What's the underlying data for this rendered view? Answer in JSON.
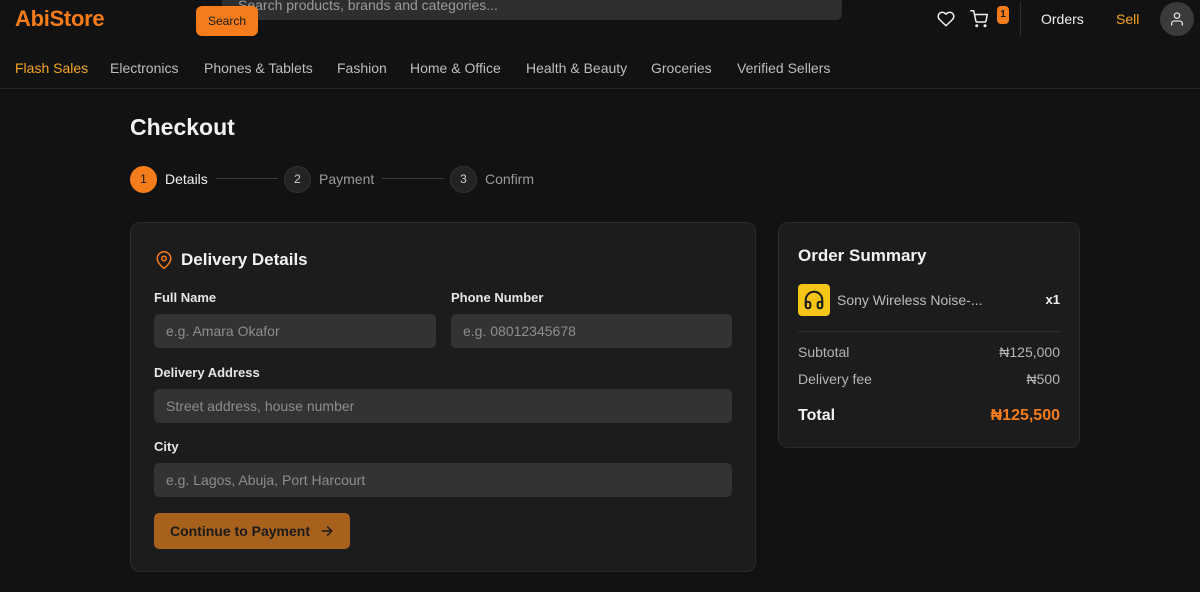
{
  "header": {
    "logo": "AbiStore",
    "search_placeholder": "Search products, brands and categories...",
    "search_button": "Search",
    "cart_count": "1",
    "orders_label": "Orders",
    "sell_label": "Sell",
    "brand_color": "#f57c1a"
  },
  "categories": [
    "Flash Sales",
    "Electronics",
    "Phones & Tablets",
    "Fashion",
    "Home & Office",
    "Health & Beauty",
    "Groceries",
    "Verified Sellers"
  ],
  "checkout": {
    "title": "Checkout",
    "steps": [
      {
        "num": "1",
        "label": "Details",
        "active": true
      },
      {
        "num": "2",
        "label": "Payment",
        "active": false
      },
      {
        "num": "3",
        "label": "Confirm",
        "active": false
      }
    ]
  },
  "delivery": {
    "title": "Delivery Details",
    "full_name_label": "Full Name",
    "full_name_placeholder": "e.g. Amara Okafor",
    "phone_label": "Phone Number",
    "phone_placeholder": "e.g. 08012345678",
    "address_label": "Delivery Address",
    "address_placeholder": "Street address, house number",
    "city_label": "City",
    "city_placeholder": "e.g. Lagos, Abuja, Port Harcourt",
    "continue_button": "Continue to Payment"
  },
  "summary": {
    "title": "Order Summary",
    "item_name": "Sony Wireless Noise-...",
    "item_qty": "x1",
    "subtotal_label": "Subtotal",
    "subtotal_value": "₦125,000",
    "delivery_label": "Delivery fee",
    "delivery_value": "₦500",
    "total_label": "Total",
    "total_value": "₦125,500"
  }
}
